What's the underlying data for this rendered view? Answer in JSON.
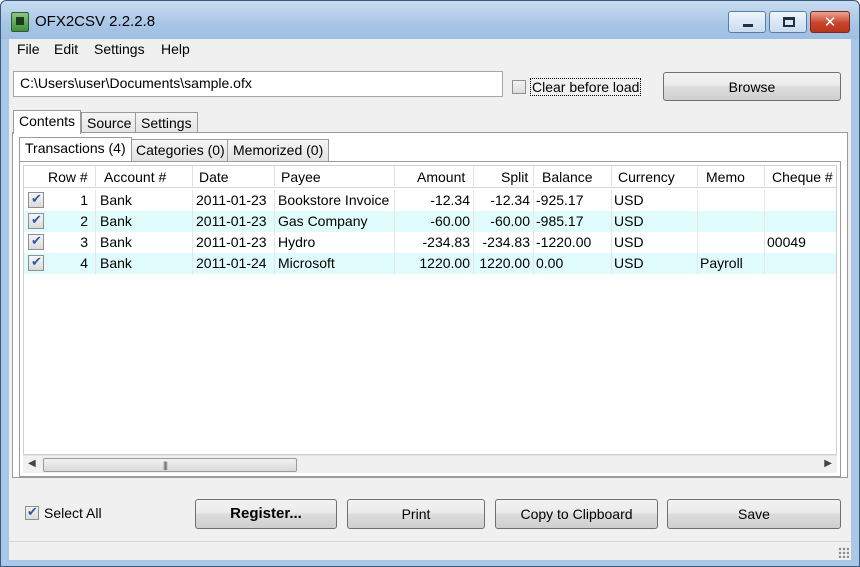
{
  "window": {
    "title": "OFX2CSV 2.2.2.8"
  },
  "menu": [
    "File",
    "Edit",
    "Settings",
    "Help"
  ],
  "file": {
    "path": "C:\\Users\\user\\Documents\\sample.ofx",
    "clear_label": "Clear before load",
    "clear_checked": false,
    "browse_label": "Browse"
  },
  "outer_tabs": [
    "Contents",
    "Source",
    "Settings"
  ],
  "inner_tabs": [
    "Transactions (4)",
    "Categories (0)",
    "Memorized (0)"
  ],
  "table": {
    "columns": [
      "Row #",
      "Account #",
      "Date",
      "Payee",
      "Amount",
      "Split",
      "Balance",
      "Currency",
      "Memo",
      "Cheque #"
    ],
    "rows": [
      {
        "checked": true,
        "row": "1",
        "account": "Bank",
        "date": "2011-01-23",
        "payee": "Bookstore Invoice",
        "amount": "-12.34",
        "split": "-12.34",
        "balance": "-925.17",
        "currency": "USD",
        "memo": "",
        "cheque": ""
      },
      {
        "checked": true,
        "row": "2",
        "account": "Bank",
        "date": "2011-01-23",
        "payee": "Gas Company",
        "amount": "-60.00",
        "split": "-60.00",
        "balance": "-985.17",
        "currency": "USD",
        "memo": "",
        "cheque": ""
      },
      {
        "checked": true,
        "row": "3",
        "account": "Bank",
        "date": "2011-01-23",
        "payee": "Hydro",
        "amount": "-234.83",
        "split": "-234.83",
        "balance": "-1220.00",
        "currency": "USD",
        "memo": "",
        "cheque": "00049"
      },
      {
        "checked": true,
        "row": "4",
        "account": "Bank",
        "date": "2011-01-24",
        "payee": "Microsoft",
        "amount": "1220.00",
        "split": "1220.00",
        "balance": "0.00",
        "currency": "USD",
        "memo": "Payroll",
        "cheque": ""
      }
    ]
  },
  "bottom": {
    "select_all_label": "Select All",
    "select_all_checked": true,
    "register_label": "Register...",
    "print_label": "Print",
    "copy_label": "Copy to Clipboard",
    "save_label": "Save"
  },
  "icons": {
    "app": "app-icon",
    "minimize": "minimize-icon",
    "maximize": "maximize-icon",
    "close": "close-icon",
    "resize": "resize-grip-icon"
  },
  "colors": {
    "alt_row": "#e0fbfb",
    "title_bar": "#a8c6e6",
    "close_button": "#c8442a"
  }
}
